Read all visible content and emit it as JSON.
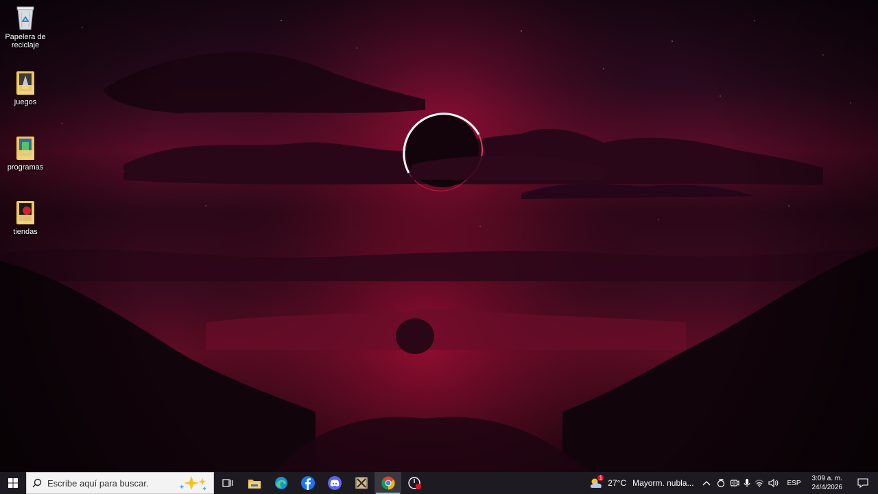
{
  "desktop": {
    "icons": [
      {
        "label": "Papelera de\nreciclaje",
        "icon": "recycle-bin-icon"
      },
      {
        "label": "juegos",
        "icon": "folder-icon"
      },
      {
        "label": "programas",
        "icon": "folder-icon"
      },
      {
        "label": "tiendas",
        "icon": "folder-icon"
      }
    ]
  },
  "taskbar": {
    "search_placeholder": "Escribe aquí para buscar.",
    "apps": [
      {
        "name": "task-view",
        "icon": "task-view-icon"
      },
      {
        "name": "file-explorer",
        "icon": "folder-icon"
      },
      {
        "name": "edge",
        "icon": "edge-icon"
      },
      {
        "name": "facebook",
        "icon": "facebook-icon"
      },
      {
        "name": "discord",
        "icon": "discord-icon"
      },
      {
        "name": "game",
        "icon": "crossed-swords-icon"
      },
      {
        "name": "chrome",
        "icon": "chrome-icon",
        "active": true
      },
      {
        "name": "recorder",
        "icon": "record-icon"
      }
    ],
    "tray": {
      "weather": {
        "temp": "27°C",
        "condition": "Mayorm. nubla...",
        "badge": "1"
      },
      "language": "ESP",
      "time": "3:09 a. m.",
      "date": "24/4/2026"
    }
  },
  "colors": {
    "taskbar": "#1d1b21",
    "accent": "#76b9ed",
    "wallpaper_red": "#8a0f2e"
  }
}
